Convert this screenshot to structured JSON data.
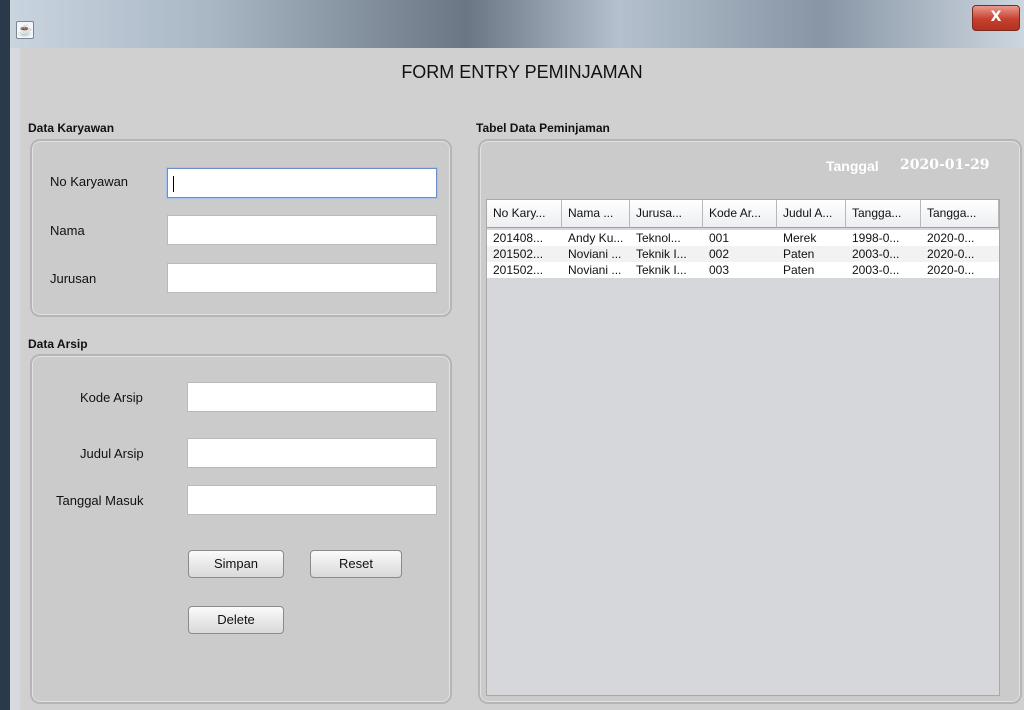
{
  "window": {
    "close_label": "X"
  },
  "form_title": "FORM ENTRY PEMINJAMAN",
  "karyawan": {
    "title": "Data Karyawan",
    "no_label": "No Karyawan",
    "nama_label": "Nama",
    "jurusan_label": "Jurusan",
    "no_value": "",
    "nama_value": "",
    "jurusan_value": ""
  },
  "arsip": {
    "title": "Data Arsip",
    "kode_label": "Kode Arsip",
    "judul_label": "Judul Arsip",
    "tanggal_label": "Tanggal Masuk",
    "kode_value": "",
    "judul_value": "",
    "tanggal_value": ""
  },
  "buttons": {
    "simpan": "Simpan",
    "reset": "Reset",
    "delete": "Delete"
  },
  "table_panel": {
    "title": "Tabel Data Peminjaman",
    "tanggal_label": "Tanggal",
    "tanggal_value": "2020-01-29"
  },
  "table": {
    "columns": [
      "No Kary...",
      "Nama ...",
      "Jurusa...",
      "Kode Ar...",
      "Judul A...",
      "Tangga...",
      "Tangga..."
    ],
    "rows": [
      [
        "201408...",
        "Andy Ku...",
        "Teknol...",
        "001",
        "Merek",
        "1998-0...",
        "2020-0..."
      ],
      [
        "201502...",
        "Noviani ...",
        "Teknik I...",
        "002",
        "Paten",
        "2003-0...",
        "2020-0..."
      ],
      [
        "201502...",
        "Noviani ...",
        "Teknik I...",
        "003",
        "Paten",
        "2003-0...",
        "2020-0..."
      ]
    ]
  },
  "icons": {
    "app": "java-cup-icon",
    "close": "close-icon"
  },
  "colors": {
    "close_button": "#c7402e",
    "panel_bg": "#cbcbcb",
    "row_alt": "#f2f2f2"
  }
}
